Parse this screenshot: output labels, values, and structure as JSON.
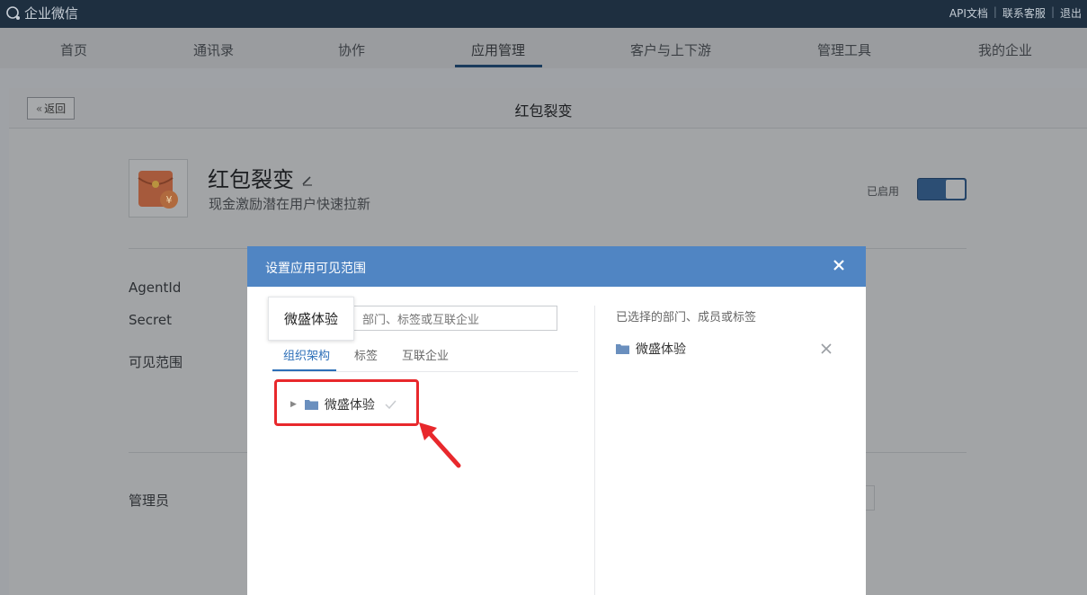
{
  "header": {
    "logo_text": "企业微信",
    "links": [
      "API文档",
      "联系客服",
      "退出"
    ]
  },
  "nav": {
    "items": [
      "首页",
      "通讯录",
      "协作",
      "应用管理",
      "客户与上下游",
      "管理工具",
      "我的企业"
    ],
    "active": "应用管理"
  },
  "page": {
    "back_label": "返回",
    "title": "红包裂变"
  },
  "app": {
    "icon": "red-envelope-icon",
    "name": "红包裂变",
    "description": "现金激励潜在用户快速拉新",
    "status_label": "已启用",
    "enabled": true
  },
  "fields": {
    "agentid_label": "AgentId",
    "secret_label": "Secret",
    "visibility_label": "可见范围",
    "admin_label": "管理员"
  },
  "modal": {
    "title": "设置应用可见范围",
    "search_placeholder": "部门、标签或互联企业",
    "tooltip": "微盛体验",
    "tabs": [
      "组织架构",
      "标签",
      "互联企业"
    ],
    "active_tab": "组织架构",
    "tree": [
      {
        "label": "微盛体验",
        "checked": true
      }
    ],
    "selected_title": "已选择的部门、成员或标签",
    "selected_items": [
      "微盛体验"
    ]
  },
  "colors": {
    "modal_header": "#5085c3",
    "accent": "#2d6fb8",
    "highlight": "#e8282c",
    "topbar": "#1e2f40"
  }
}
